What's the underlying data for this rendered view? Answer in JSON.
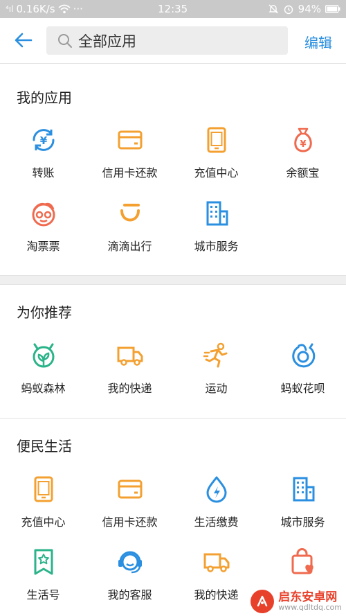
{
  "status_bar": {
    "signal": "⁴ıl",
    "speed": "0.16K/s",
    "dots": "···",
    "time": "12:35",
    "battery": "94%"
  },
  "header": {
    "search_text": "全部应用",
    "edit_label": "编辑"
  },
  "sections": [
    {
      "title": "我的应用",
      "items": [
        {
          "label": "转账",
          "icon": "transfer-icon",
          "color": "#2a8fe0"
        },
        {
          "label": "信用卡还款",
          "icon": "credit-card-icon",
          "color": "#f3a030"
        },
        {
          "label": "充值中心",
          "icon": "phone-recharge-icon",
          "color": "#f3a030"
        },
        {
          "label": "余额宝",
          "icon": "money-bag-icon",
          "color": "#ef6a4e"
        },
        {
          "label": "淘票票",
          "icon": "taopiaopiao-icon",
          "color": "#ef6a4e"
        },
        {
          "label": "滴滴出行",
          "icon": "didi-icon",
          "color": "#f3a030"
        },
        {
          "label": "城市服务",
          "icon": "city-building-icon",
          "color": "#2a8fe0"
        }
      ]
    },
    {
      "title": "为你推荐",
      "items": [
        {
          "label": "蚂蚁森林",
          "icon": "ant-forest-icon",
          "color": "#2bb38a"
        },
        {
          "label": "我的快递",
          "icon": "delivery-truck-icon",
          "color": "#f3a030"
        },
        {
          "label": "运动",
          "icon": "running-icon",
          "color": "#f3a030"
        },
        {
          "label": "蚂蚁花呗",
          "icon": "huabei-icon",
          "color": "#2a8fe0"
        }
      ]
    },
    {
      "title": "便民生活",
      "items": [
        {
          "label": "充值中心",
          "icon": "phone-recharge-icon",
          "color": "#f3a030"
        },
        {
          "label": "信用卡还款",
          "icon": "credit-card-icon",
          "color": "#f3a030"
        },
        {
          "label": "生活缴费",
          "icon": "water-drop-icon",
          "color": "#2a8fe0"
        },
        {
          "label": "城市服务",
          "icon": "city-building-icon",
          "color": "#2a8fe0"
        },
        {
          "label": "生活号",
          "icon": "life-account-icon",
          "color": "#2bb38a"
        },
        {
          "label": "我的客服",
          "icon": "customer-service-icon",
          "color": "#2a8fe0"
        },
        {
          "label": "我的快递",
          "icon": "delivery-truck-icon",
          "color": "#f3a030"
        },
        {
          "label": "",
          "icon": "shopping-bag-heart-icon",
          "color": "#ef6a4e"
        }
      ]
    }
  ],
  "watermark": {
    "name": "启东安卓网",
    "url": "www.qdltdq.com"
  }
}
